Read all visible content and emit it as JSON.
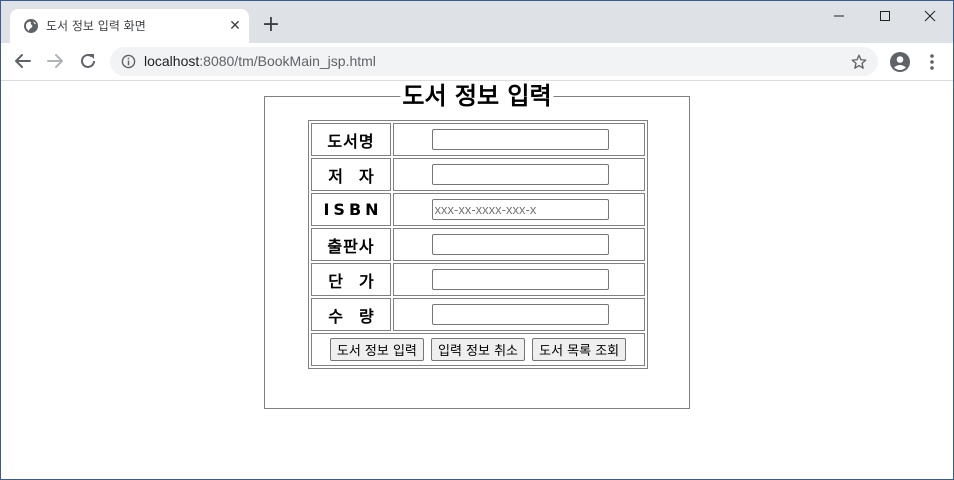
{
  "browser": {
    "tab": {
      "title": "도서 정보 입력 화면",
      "close_symbol": "✕"
    },
    "new_tab_symbol": "+",
    "window_controls": [
      "minimize-icon",
      "maximize-icon",
      "close-icon"
    ],
    "address": {
      "host": "localhost",
      "path": ":8080/tm/BookMain_jsp.html"
    },
    "icons": [
      "back-arrow-icon",
      "forward-arrow-icon",
      "reload-icon",
      "info-icon",
      "star-icon",
      "profile-icon",
      "menu-icon"
    ]
  },
  "form": {
    "legend": "도서 정보 입력",
    "fields": [
      {
        "label": "도서명",
        "value": "",
        "placeholder": ""
      },
      {
        "label": "저자",
        "value": "",
        "placeholder": ""
      },
      {
        "label": "ISBN",
        "value": "",
        "placeholder": "xxx-xx-xxxx-xxx-x"
      },
      {
        "label": "출판사",
        "value": "",
        "placeholder": ""
      },
      {
        "label": "단가",
        "value": "",
        "placeholder": ""
      },
      {
        "label": "수량",
        "value": "",
        "placeholder": ""
      }
    ],
    "buttons": {
      "submit": "도서 정보 입력",
      "reset": "입력 정보 취소",
      "list": "도서 목록 조회"
    }
  },
  "colors": {
    "tabstrip_bg": "#dee1e6",
    "omnibox_bg": "#f1f3f4",
    "border": "#808080",
    "button_bg": "#efefef"
  }
}
